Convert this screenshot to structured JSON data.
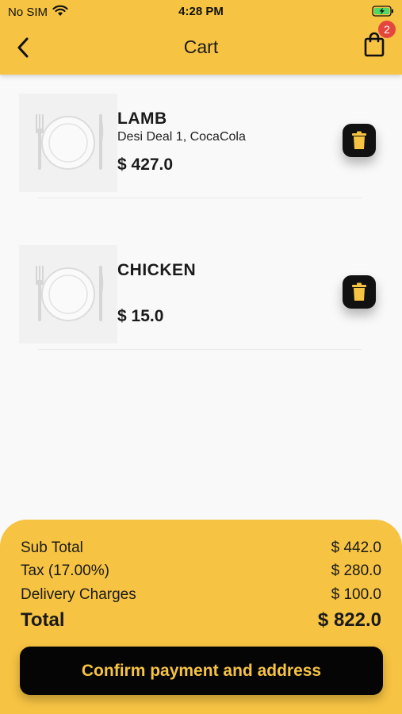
{
  "status_bar": {
    "carrier": "No SIM",
    "time": "4:28 PM",
    "wifi_icon": "wifi-icon",
    "battery_icon": "battery-charging-icon"
  },
  "header": {
    "title": "Cart",
    "back_icon": "chevron-left-icon",
    "cart_icon": "shopping-bag-icon",
    "cart_count": "2",
    "color": "#f6c342"
  },
  "cart_items": [
    {
      "name": "LAMB",
      "description": "Desi Deal 1, CocaCola",
      "price": "$ 427.0",
      "image_icon": "plate-cutlery-icon",
      "delete_icon": "trash-icon"
    },
    {
      "name": "CHICKEN",
      "description": "",
      "price": "$ 15.0",
      "image_icon": "plate-cutlery-icon",
      "delete_icon": "trash-icon"
    }
  ],
  "summary": {
    "sub_total_label": "Sub Total",
    "sub_total_value": "$ 442.0",
    "tax_label": "Tax (17.00%)",
    "tax_value": "$ 280.0",
    "delivery_label": "Delivery Charges",
    "delivery_value": "$ 100.0",
    "total_label": "Total",
    "total_value": "$ 822.0",
    "confirm_label": "Confirm payment and address"
  },
  "colors": {
    "accent": "#f6c342",
    "button": "#050505",
    "badge": "#e5453f"
  }
}
